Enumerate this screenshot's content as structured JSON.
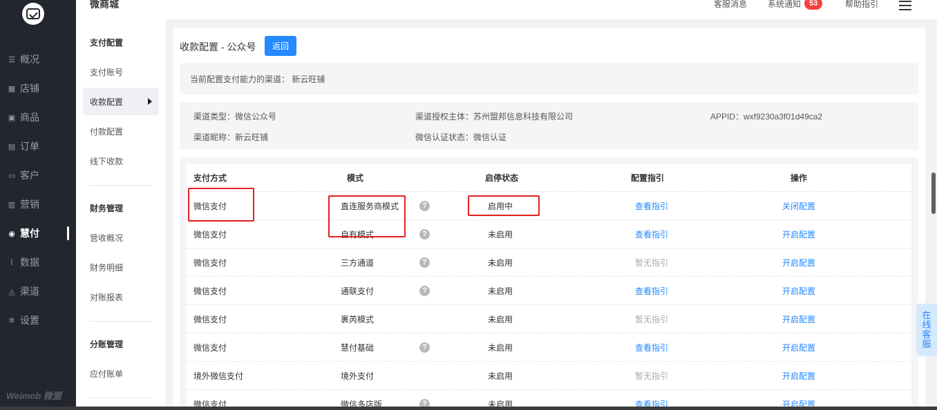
{
  "sidebar": {
    "logo": "weimob-logo",
    "items": [
      {
        "label": "概况",
        "icon": "overview-icon",
        "glyph": "☰"
      },
      {
        "label": "店铺",
        "icon": "store-icon",
        "glyph": "▦"
      },
      {
        "label": "商品",
        "icon": "goods-icon",
        "glyph": "▣"
      },
      {
        "label": "订单",
        "icon": "order-icon",
        "glyph": "▤"
      },
      {
        "label": "客户",
        "icon": "customer-icon",
        "glyph": "▭"
      },
      {
        "label": "营销",
        "icon": "marketing-icon",
        "glyph": "▥"
      },
      {
        "label": "慧付",
        "icon": "pay-icon",
        "glyph": "◉"
      },
      {
        "label": "数据",
        "icon": "data-icon",
        "glyph": "⌇"
      },
      {
        "label": "渠道",
        "icon": "channel-icon",
        "glyph": "◬"
      },
      {
        "label": "设置",
        "icon": "settings-icon",
        "glyph": "✲"
      }
    ],
    "active_index": 6,
    "brand": "Weimob 微盟"
  },
  "header": {
    "title": "微商城",
    "links": [
      "客服消息",
      "系统通知",
      "帮助指引"
    ],
    "notice_count": "53"
  },
  "subnav": {
    "groups": [
      {
        "title": "支付配置",
        "items": [
          "支付账号",
          "收款配置",
          "付款配置",
          "线下收款"
        ]
      },
      {
        "title": "财务管理",
        "items": [
          "营收概况",
          "财务明细",
          "对账报表"
        ]
      },
      {
        "title": "分账管理",
        "items": [
          "应付账单"
        ]
      }
    ],
    "active_item": "收款配置"
  },
  "main": {
    "title": "收款配置 - 公众号",
    "back_label": "返回",
    "current_channel_text": "当前配置支付能力的渠道：  新云旺铺",
    "details": {
      "channel_type": "渠道类型：微信公众号",
      "auth_subject": "渠道授权主体：苏州盟邦信息科技有限公司",
      "appid": "APPID：wxf9230a3f01d49ca2",
      "nickname": "渠道昵称：新云旺铺",
      "cert_status": "微信认证状态：微信认证"
    },
    "table": {
      "headers": [
        "支付方式",
        "模式",
        "启停状态",
        "配置指引",
        "操作"
      ],
      "rows": [
        {
          "method": "微信支付",
          "mode": "直连服务商模式",
          "help": true,
          "status": "启用中",
          "guide": "查看指引",
          "guide_enabled": true,
          "toggle": "关闭",
          "config": "配置"
        },
        {
          "method": "微信支付",
          "mode": "自有模式",
          "help": true,
          "status": "未启用",
          "guide": "查看指引",
          "guide_enabled": true,
          "toggle": "开启",
          "config": "配置"
        },
        {
          "method": "微信支付",
          "mode": "三方通道",
          "help": true,
          "status": "未启用",
          "guide": "暂无指引",
          "guide_enabled": false,
          "toggle": "开启",
          "config": "配置"
        },
        {
          "method": "微信支付",
          "mode": "通联支付",
          "help": true,
          "status": "未启用",
          "guide": "查看指引",
          "guide_enabled": true,
          "toggle": "开启",
          "config": "配置"
        },
        {
          "method": "微信支付",
          "mode": "裹芮模式",
          "help": false,
          "status": "未启用",
          "guide": "暂无指引",
          "guide_enabled": false,
          "toggle": "开启",
          "config": "配置"
        },
        {
          "method": "微信支付",
          "mode": "慧付基础",
          "help": true,
          "status": "未启用",
          "guide": "查看指引",
          "guide_enabled": true,
          "toggle": "开启",
          "config": "配置"
        },
        {
          "method": "境外微信支付",
          "mode": "境外支付",
          "help": false,
          "status": "未启用",
          "guide": "暂无指引",
          "guide_enabled": false,
          "toggle": "开启",
          "config": "配置"
        },
        {
          "method": "微信支付",
          "mode": "微信多店版",
          "help": true,
          "status": "未启用",
          "guide": "查看指引",
          "guide_enabled": true,
          "toggle": "开启",
          "config": "配置"
        }
      ]
    }
  },
  "service_tab": "在线客服",
  "colors": {
    "accent": "#2589ff",
    "sidebar_bg": "#23262e",
    "badge": "#f5403d",
    "highlight_box": "#e32020"
  }
}
